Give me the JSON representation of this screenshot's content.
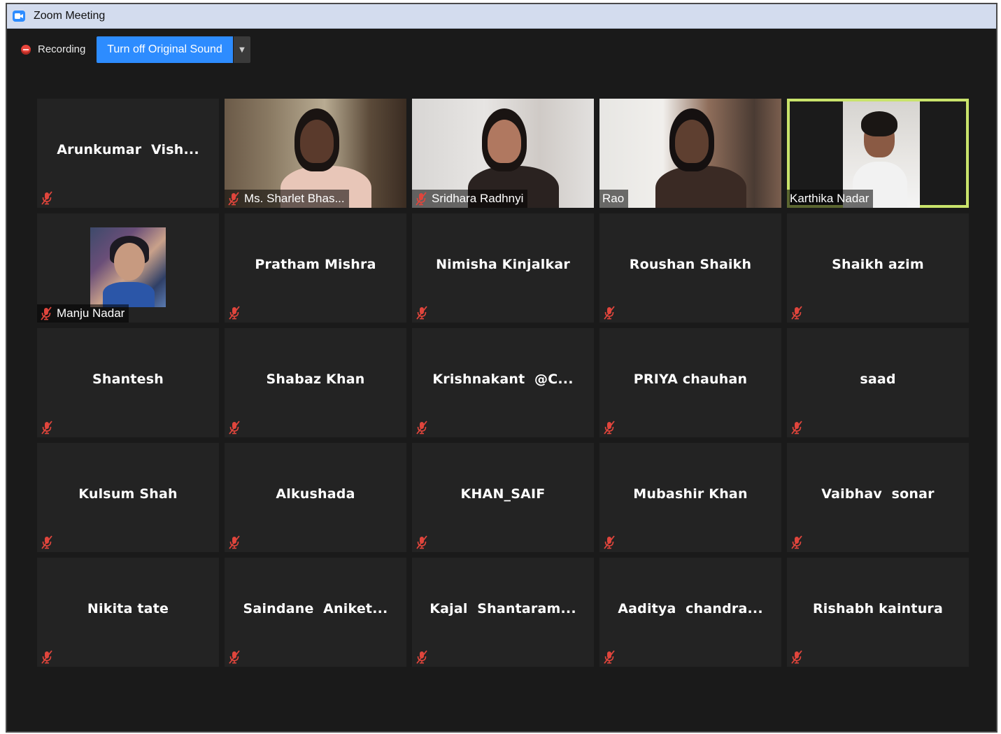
{
  "window": {
    "title": "Zoom Meeting",
    "app_icon": "zoom-camera-icon"
  },
  "toolbar": {
    "recording_label": "Recording",
    "sound_button_label": "Turn off Original Sound",
    "accent_color": "#2d8cff"
  },
  "participants": [
    {
      "name": "Arunkumar  Vish...",
      "video": false,
      "muted": true
    },
    {
      "name": "Ms. Sharlet Bhas...",
      "video": true,
      "muted": true
    },
    {
      "name": "Sridhara Radhnyi",
      "video": true,
      "muted": true
    },
    {
      "name": "Rao",
      "video": true,
      "muted": false
    },
    {
      "name": "Karthika Nadar",
      "video": true,
      "muted": false,
      "active_speaker": true
    },
    {
      "name": "Manju Nadar",
      "video": false,
      "avatar": true,
      "muted": true
    },
    {
      "name": "Pratham Mishra",
      "video": false,
      "muted": true
    },
    {
      "name": "Nimisha Kinjalkar",
      "video": false,
      "muted": true
    },
    {
      "name": "Roushan Shaikh",
      "video": false,
      "muted": true
    },
    {
      "name": "Shaikh azim",
      "video": false,
      "muted": true
    },
    {
      "name": "Shantesh",
      "video": false,
      "muted": true
    },
    {
      "name": "Shabaz Khan",
      "video": false,
      "muted": true
    },
    {
      "name": "Krishnakant  @C...",
      "video": false,
      "muted": true
    },
    {
      "name": "PRIYA chauhan",
      "video": false,
      "muted": true
    },
    {
      "name": "saad",
      "video": false,
      "muted": true
    },
    {
      "name": "Kulsum Shah",
      "video": false,
      "muted": true
    },
    {
      "name": "Alkushada",
      "video": false,
      "muted": true
    },
    {
      "name": "KHAN_SAIF",
      "video": false,
      "muted": true
    },
    {
      "name": "Mubashir Khan",
      "video": false,
      "muted": true
    },
    {
      "name": "Vaibhav  sonar",
      "video": false,
      "muted": true
    },
    {
      "name": "Nikita tate",
      "video": false,
      "muted": true
    },
    {
      "name": "Saindane  Aniket...",
      "video": false,
      "muted": true
    },
    {
      "name": "Kajal  Shantaram...",
      "video": false,
      "muted": true
    },
    {
      "name": "Aaditya  chandra...",
      "video": false,
      "muted": true
    },
    {
      "name": "Rishabh kaintura",
      "video": false,
      "muted": true
    }
  ],
  "colors": {
    "active_speaker_border": "#c9e36b",
    "mute_icon": "#e0453c"
  }
}
